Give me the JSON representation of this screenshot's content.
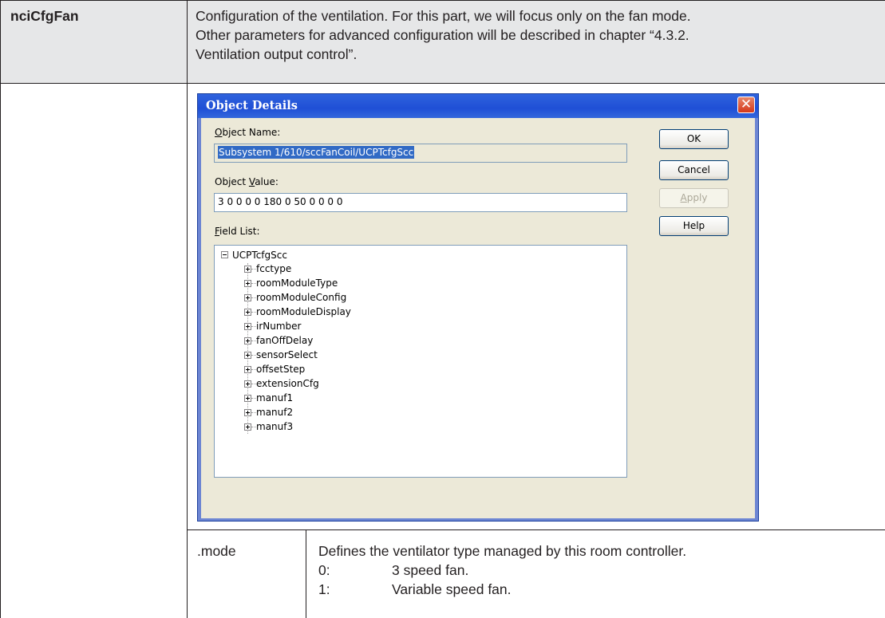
{
  "table": {
    "param_name": "nciCfgFan",
    "description_lines": [
      "Configuration of the ventilation. For this part, we will focus only on the fan mode.",
      "Other parameters for advanced configuration will be described in chapter “4.3.2.",
      "Ventilation output control”."
    ],
    "subfield": ".mode",
    "subfield_description": "Defines the ventilator type managed by this room controller.",
    "options": [
      {
        "code": "0:",
        "label": "3 speed fan."
      },
      {
        "code": "1:",
        "label": "Variable speed fan."
      }
    ]
  },
  "dialog": {
    "title": "Object Details",
    "close_glyph": "✕",
    "object_name": {
      "label_first": "O",
      "label_rest": "bject Name:",
      "value": "Subsystem 1/610/sccFanCoil/UCPTcfgScc"
    },
    "object_value": {
      "label_pre": "Object ",
      "label_ul": "V",
      "label_post": "alue:",
      "value": "3 0 0 0 0 180 0 50 0 0 0 0"
    },
    "field_list": {
      "label_ul": "F",
      "label_rest": "ield List:"
    },
    "buttons": {
      "ok": "OK",
      "cancel": "Cancel",
      "apply_ul": "A",
      "apply_rest": "pply",
      "help": "Help"
    },
    "tree": {
      "root": "UCPTcfgScc",
      "children": [
        "fcctype",
        "roomModuleType",
        "roomModuleConfig",
        "roomModuleDisplay",
        "irNumber",
        "fanOffDelay",
        "sensorSelect",
        "offsetStep",
        "extensionCfg",
        "manuf1",
        "manuf2",
        "manuf3"
      ]
    }
  },
  "colors": {
    "header_bg": "#e6e7e8",
    "title_bar": "#1f4fd6",
    "dialog_face": "#ece9d8",
    "selection": "#316ac5",
    "close_button": "#d4381a"
  }
}
